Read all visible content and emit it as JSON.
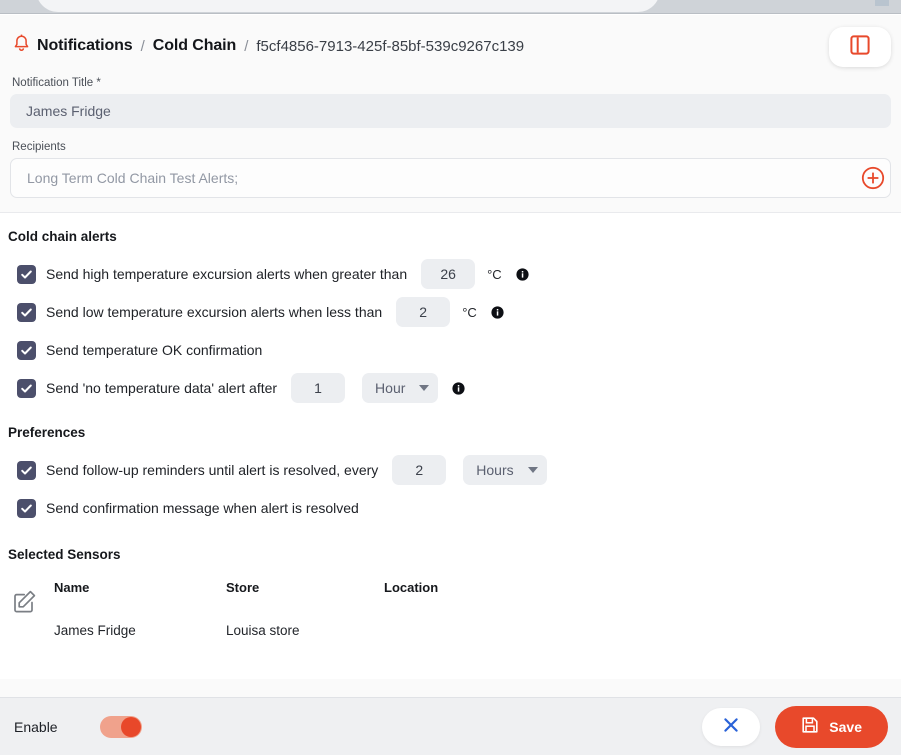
{
  "topbar": {
    "search_placeholder": "",
    "search_icon": "search-icon"
  },
  "header": {
    "bell_icon": "bell-icon",
    "breadcrumb": {
      "root": "Notifications",
      "separator": "/",
      "category": "Cold Chain",
      "id": "f5cf4856-7913-425f-85bf-539c9267c139"
    },
    "panel_toggle_icon": "panel-layout-icon"
  },
  "form": {
    "title_field": {
      "label": "Notification Title *",
      "value": "James Fridge"
    },
    "recipients_field": {
      "label": "Recipients",
      "value": "Long Term Cold Chain Test Alerts;",
      "placeholder": "Long Term Cold Chain Test Alerts;",
      "add_icon": "plus-circle-icon"
    }
  },
  "cold_chain": {
    "section_title": "Cold chain alerts",
    "rows": [
      {
        "checked": true,
        "label": "Send high temperature excursion alerts when greater than",
        "value": "26",
        "unit": "°C",
        "info": true
      },
      {
        "checked": true,
        "label": "Send low temperature excursion alerts when less than",
        "value": "2",
        "unit": "°C",
        "info": true
      },
      {
        "checked": true,
        "label": "Send temperature OK confirmation"
      },
      {
        "checked": true,
        "label": "Send 'no temperature data' alert after",
        "value": "1",
        "select": "Hour",
        "info": true
      }
    ]
  },
  "preferences": {
    "section_title": "Preferences",
    "rows": [
      {
        "checked": true,
        "label": "Send follow-up reminders until alert is resolved, every",
        "value": "2",
        "select": "Hours"
      },
      {
        "checked": true,
        "label": "Send confirmation message when alert is resolved"
      }
    ]
  },
  "sensors": {
    "section_title": "Selected Sensors",
    "edit_icon": "edit-pencil-icon",
    "columns": [
      "Name",
      "Store",
      "Location"
    ],
    "rows": [
      {
        "name": "James Fridge",
        "store": "Louisa store",
        "location": ""
      }
    ]
  },
  "footer": {
    "enable_label": "Enable",
    "enable_on": true,
    "cancel_icon": "close-x-icon",
    "save_icon": "save-disk-icon",
    "save_label": "Save"
  },
  "colors": {
    "accent": "#e8492b",
    "checkbox": "#4c4f6b",
    "cancel_x": "#2962d8",
    "toggle_track": "#f0a28c"
  }
}
